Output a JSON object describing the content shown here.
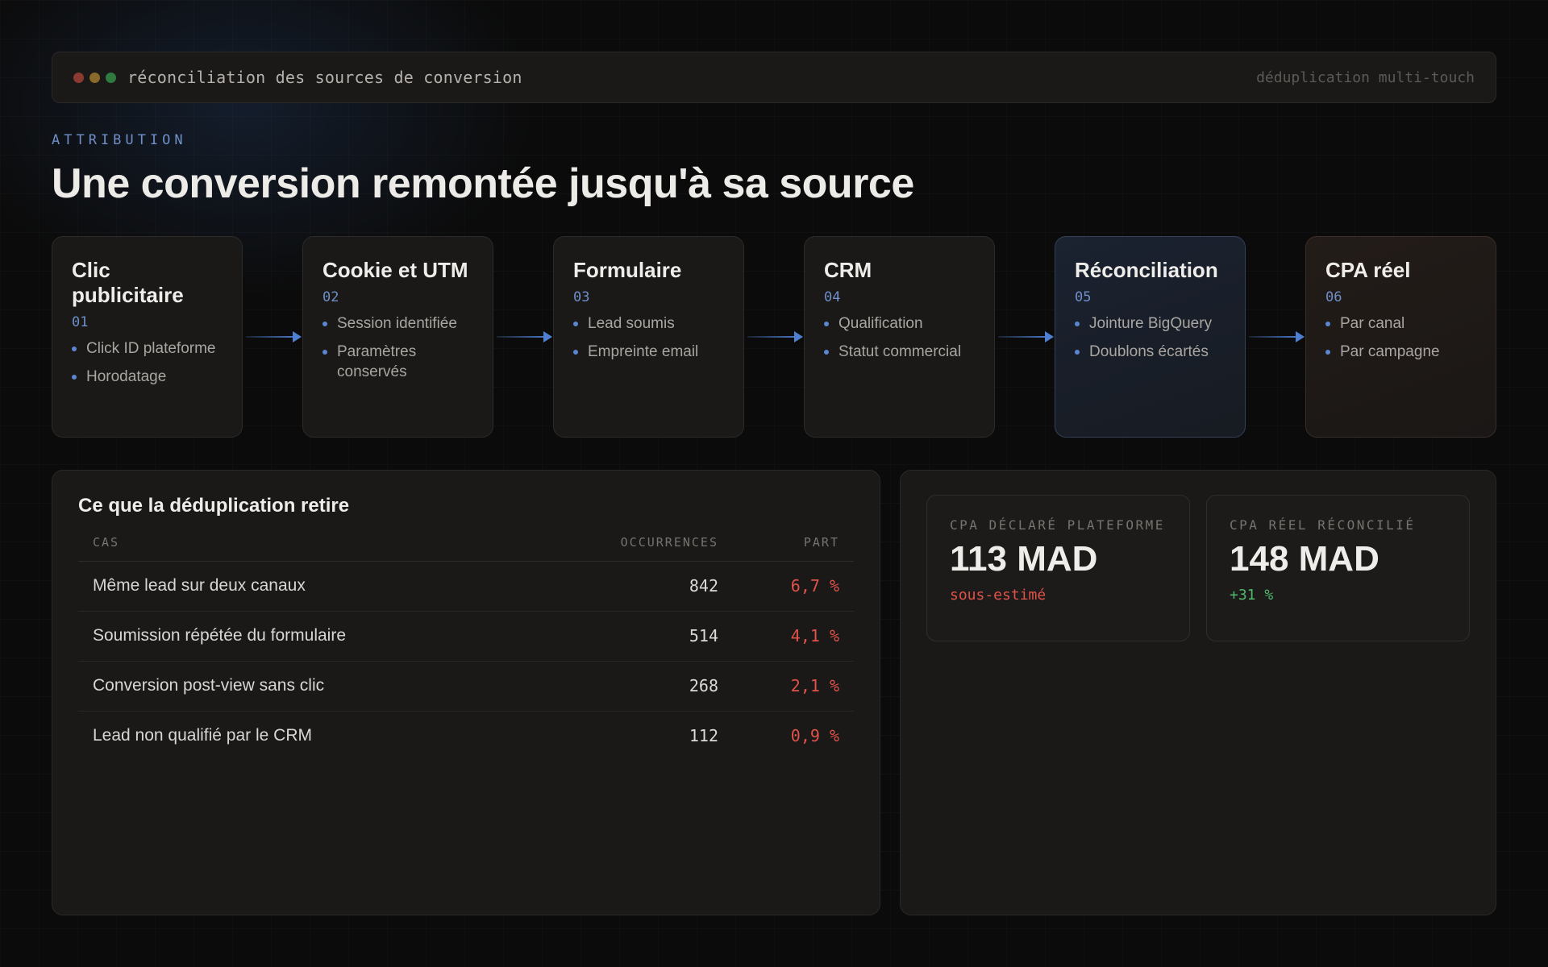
{
  "titlebar": {
    "title": "réconciliation des sources de conversion",
    "right_label": "déduplication multi-touch",
    "dot_colors": [
      "#8a3a30",
      "#8a6a2a",
      "#2f7a3e"
    ]
  },
  "header": {
    "eyebrow": "ATTRIBUTION",
    "title": "Une conversion remontée jusqu'à sa source"
  },
  "pipeline": [
    {
      "name": "Clic publicitaire",
      "num": "01",
      "items": [
        "Click ID plateforme",
        "Horodatage"
      ]
    },
    {
      "name": "Cookie et UTM",
      "num": "02",
      "items": [
        "Session identifiée",
        "Paramètres conservés"
      ]
    },
    {
      "name": "Formulaire",
      "num": "03",
      "items": [
        "Lead soumis",
        "Empreinte email"
      ]
    },
    {
      "name": "CRM",
      "num": "04",
      "items": [
        "Qualification",
        "Statut commercial"
      ]
    },
    {
      "name": "Réconciliation",
      "num": "05",
      "items": [
        "Jointure BigQuery",
        "Doublons écartés"
      ]
    },
    {
      "name": "CPA réel",
      "num": "06",
      "items": [
        "Par canal",
        "Par campagne"
      ]
    }
  ],
  "dedup": {
    "title": "Ce que la déduplication retire",
    "columns": [
      "CAS",
      "OCCURRENCES",
      "PART"
    ],
    "rows": [
      {
        "case": "Même lead sur deux canaux",
        "occurrences": "842",
        "part": "6,7 %"
      },
      {
        "case": "Soumission répétée du formulaire",
        "occurrences": "514",
        "part": "4,1 %"
      },
      {
        "case": "Conversion post-view sans clic",
        "occurrences": "268",
        "part": "2,1 %"
      },
      {
        "case": "Lead non qualifié par le CRM",
        "occurrences": "112",
        "part": "0,9 %"
      }
    ]
  },
  "kpis": {
    "declared": {
      "label": "CPA DÉCLARÉ PLATEFORME",
      "value": "113 MAD",
      "note": "sous-estimé",
      "note_color": "#e0524a"
    },
    "real": {
      "label": "CPA RÉEL RÉCONCILIÉ",
      "value": "148 MAD",
      "note": "+31 %",
      "note_color": "#4fb86a"
    }
  },
  "colors": {
    "accent": "#5b86d1",
    "negative": "#e0524a",
    "positive": "#4fb86a"
  }
}
